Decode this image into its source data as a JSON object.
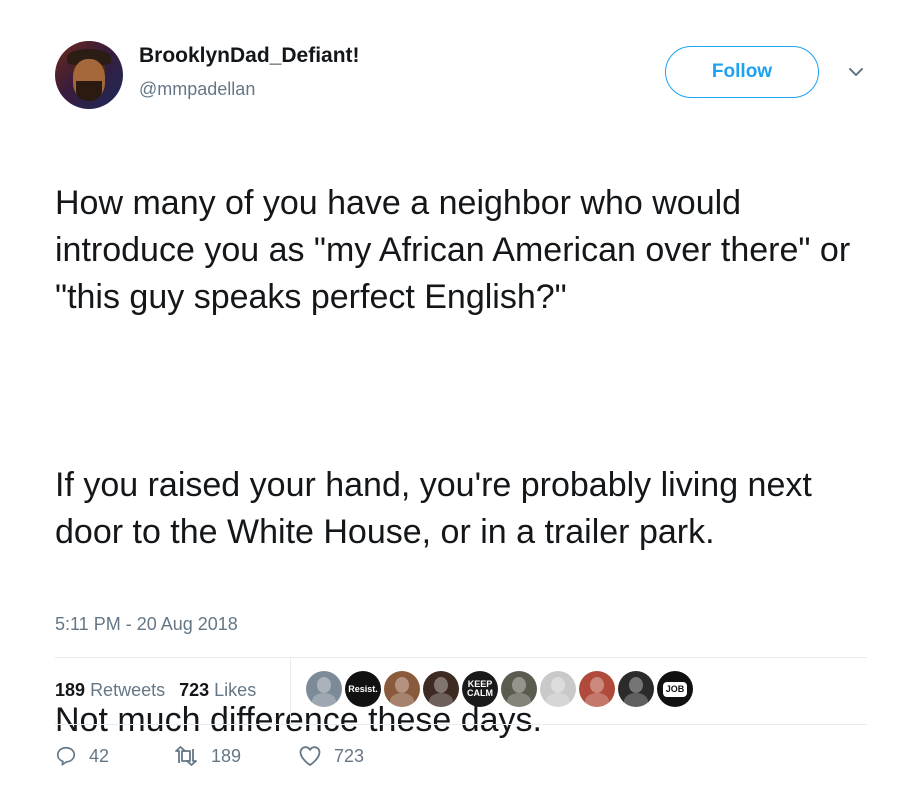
{
  "user": {
    "display_name": "BrooklynDad_Defiant!",
    "handle": "@mmpadellan"
  },
  "follow_label": "Follow",
  "tweet": {
    "paragraphs": [
      "How many of you have a neighbor who would introduce you as \"my African American over there\" or \"this guy speaks perfect English?\"",
      "If you raised your hand, you're probably living next door to the White House, or in a trailer park.",
      "Not much difference these days."
    ],
    "timestamp": "5:11 PM - 20 Aug 2018"
  },
  "stats": {
    "retweets_count": "189",
    "retweets_label": "Retweets",
    "likes_count": "723",
    "likes_label": "Likes"
  },
  "likers": [
    {
      "icon": "avatar-photo",
      "color": "#7d8b99",
      "text": ""
    },
    {
      "icon": "avatar-resist",
      "color": "#111111",
      "text": "Resist."
    },
    {
      "icon": "avatar-photo",
      "color": "#8a5a3c",
      "text": ""
    },
    {
      "icon": "avatar-photo",
      "color": "#3d2a22",
      "text": ""
    },
    {
      "icon": "avatar-keep-calm",
      "color": "#1a1a1a",
      "text": "KEEP CALM"
    },
    {
      "icon": "avatar-photo",
      "color": "#5b5b4f",
      "text": ""
    },
    {
      "icon": "avatar-photo",
      "color": "#c9c9c9",
      "text": ""
    },
    {
      "icon": "avatar-photo",
      "color": "#b04a3a",
      "text": ""
    },
    {
      "icon": "avatar-photo",
      "color": "#2b2b2b",
      "text": ""
    },
    {
      "icon": "avatar-job",
      "color": "#111111",
      "text": "JOB"
    }
  ],
  "actions": {
    "reply_count": "42",
    "retweet_count": "189",
    "like_count": "723"
  },
  "colors": {
    "accent": "#1da1f2",
    "secondary_text": "#657786",
    "divider": "#e6ecf0"
  }
}
